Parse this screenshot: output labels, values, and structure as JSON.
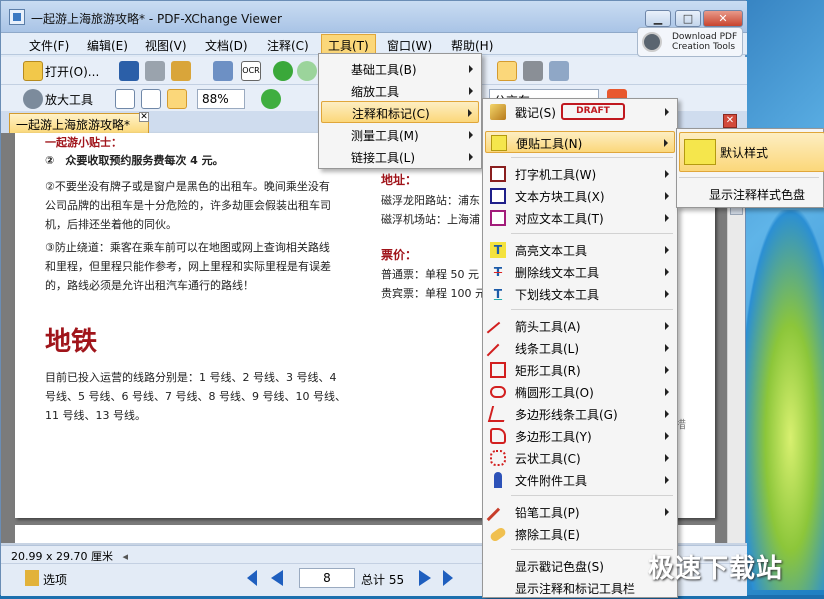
{
  "window": {
    "title": "一起游上海旅游攻略* - PDF-XChange Viewer"
  },
  "menubar": {
    "items": [
      "文件(F)",
      "编辑(E)",
      "视图(V)",
      "文档(D)",
      "注释(C)",
      "工具(T)",
      "窗口(W)",
      "帮助(H)"
    ]
  },
  "download_button": {
    "line1": "Download PDF",
    "line2": "Creation Tools"
  },
  "toolbar1": {
    "open_label": "打开(O)..."
  },
  "toolbar2": {
    "zoom_tool_label": "放大工具",
    "zoom_value": "88%",
    "search_value": "公交车"
  },
  "tab": {
    "label": "一起游上海旅游攻略*"
  },
  "tools_menu": {
    "items": [
      "基础工具(B)",
      "缩放工具",
      "注释和标记(C)",
      "测量工具(M)",
      "链接工具(L)"
    ]
  },
  "annot_menu": {
    "stamp_label": "戳记(S)",
    "stamp_badge": "DRAFT",
    "items": [
      "便贴工具(N)",
      "打字机工具(W)",
      "文本方块工具(X)",
      "对应文本工具(T)",
      "高亮文本工具",
      "删除线文本工具",
      "下划线文本工具",
      "箭头工具(A)",
      "线条工具(L)",
      "矩形工具(R)",
      "椭圆形工具(O)",
      "多边形线条工具(G)",
      "多边形工具(Y)",
      "云状工具(C)",
      "文件附件工具",
      "铅笔工具(P)",
      "擦除工具(E)",
      "显示戳记色盘(S)",
      "显示注释和标记工具栏"
    ]
  },
  "note_menu": {
    "items": [
      "默认样式",
      "显示注释样式色盘"
    ]
  },
  "page": {
    "tips_title": "一起游小贴士：",
    "tip2": "②　众要收取预约服务费每次 4 元。",
    "para1": [
      "②不要坐没有牌子或是窗户是黑色的出租车。晚间乘坐没有",
      "公司品牌的出租车是十分危险的，许多劫匪会假装出租车司",
      "机，后排还坐着他的同伙。"
    ],
    "para2": [
      "③防止绕道：乘客在乘车前可以在地图或网上查询相关路线",
      "和里程，但里程只能作参考，网上里程和实际里程是有误差",
      "的，路线必须是允许出租汽车通行的路线！"
    ],
    "metro_heading": "地铁",
    "metro_text": [
      "目前已投入运营的线路分别是：1 号线、2 号线、3 号线、4",
      "号线、5 号线、6 号线、7 号线、8 号线、9 号线、10 号线、",
      "11 号线、13 号线。"
    ],
    "addr_label": "地址：",
    "addr_lines": [
      "磁浮龙阳路站：浦东",
      "磁浮机场站：上海浦"
    ],
    "price_label": "票价：",
    "price_lines": [
      "普通票：单程 50 元",
      "贵宾票：单程 100 元"
    ],
    "side_char": "措"
  },
  "status": {
    "page_size": "20.99 x 29.70 厘米",
    "options_label": "选项",
    "current_page": "8",
    "total_label": "总计 55"
  },
  "watermark": "极速下载站"
}
